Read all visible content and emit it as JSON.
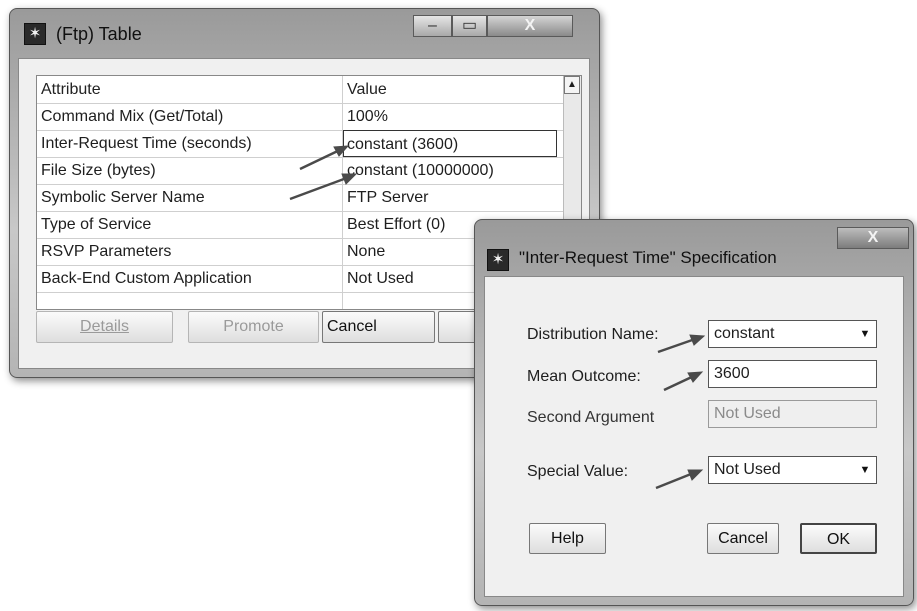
{
  "ftp_window": {
    "title": "(Ftp) Table",
    "title_icon": "✶",
    "caption_buttons": {
      "minimize": "–",
      "maximize": "▭",
      "close": "X"
    },
    "table": {
      "headers": [
        "Attribute",
        "Value"
      ],
      "rows": [
        {
          "attribute": "Command Mix (Get/Total)",
          "value": "100%"
        },
        {
          "attribute": "Inter-Request Time (seconds)",
          "value": "constant (3600)"
        },
        {
          "attribute": "File Size (bytes)",
          "value": "constant (10000000)"
        },
        {
          "attribute": "Symbolic Server Name",
          "value": "FTP Server"
        },
        {
          "attribute": "Type of Service",
          "value": "Best Effort (0)"
        },
        {
          "attribute": "RSVP Parameters",
          "value": "None"
        },
        {
          "attribute": "Back-End Custom Application",
          "value": "Not Used"
        }
      ],
      "scroll_up_glyph": "▲"
    },
    "buttons": {
      "details": {
        "label": "Details",
        "enabled": false
      },
      "promote": {
        "label": "Promote",
        "enabled": false
      },
      "cancel": {
        "label": "Cancel",
        "enabled": true
      }
    }
  },
  "spec_window": {
    "title": "\"Inter-Request Time\" Specification",
    "title_icon": "✶",
    "close_glyph": "X",
    "fields": {
      "distribution_name": {
        "label": "Distribution Name:",
        "value": "constant"
      },
      "mean_outcome": {
        "label": "Mean Outcome:",
        "value": "3600"
      },
      "second_argument": {
        "label": "Second Argument",
        "value": "Not Used",
        "enabled": false
      },
      "special_value": {
        "label": "Special Value:",
        "value": "Not Used"
      }
    },
    "dropdown_glyph": "▼",
    "buttons": {
      "help": "Help",
      "cancel": "Cancel",
      "ok": "OK"
    }
  },
  "colors": {
    "title_bar": "#b8b8b8",
    "client_bg": "#f0f0f0",
    "annotation_arrow": "#4a4a4a"
  }
}
